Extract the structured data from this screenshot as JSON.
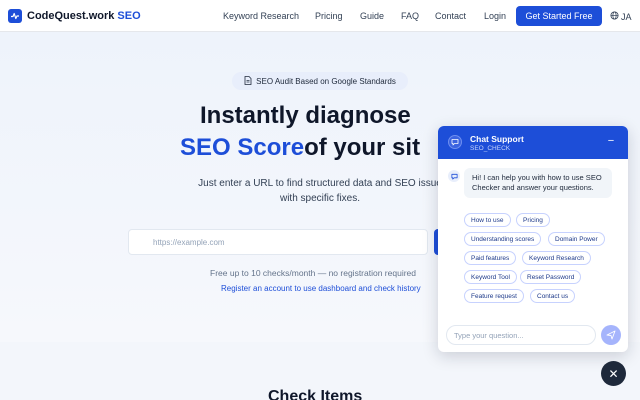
{
  "header": {
    "brand": "CodeQuest.work",
    "brand_accent": "SEO",
    "nav": [
      "Keyword Research",
      "Pricing",
      "Guide",
      "FAQ",
      "Contact",
      "Login"
    ],
    "cta": "Get Started Free",
    "lang": "JA"
  },
  "hero": {
    "badge": "SEO Audit Based on Google Standards",
    "headline_line1": "Instantly diagnose",
    "headline_blue": "SEO Score",
    "headline_rest": "of your sit",
    "subtitle_line1": "Just enter a URL to find structured data and SEO issue",
    "subtitle_line2": "with specific fixes.",
    "url_placeholder": "https://example.com",
    "free_note": "Free up to 10 checks/month — no registration required",
    "register_link": "Register an account to use dashboard and check history"
  },
  "section": {
    "title": "Check Items"
  },
  "chat": {
    "title": "Chat Support",
    "subtitle": "SEO_CHECK",
    "minimize": "−",
    "bot_message": "Hi! I can help you with how to use SEO Checker and answer your questions.",
    "chips": [
      "How to use",
      "Pricing",
      "Understanding scores",
      "Domain Power",
      "Paid features",
      "Keyword Research",
      "Keyword Tool",
      "Reset Password",
      "Feature request",
      "Contact us"
    ],
    "input_placeholder": "Type your question...",
    "close": "✕"
  },
  "colors": {
    "accent": "#1d4ed8",
    "dark": "#0f172a"
  },
  "icons": [
    "pulse-icon",
    "globe-icon",
    "document-icon",
    "chat-bubble-icon",
    "send-icon",
    "close-icon"
  ]
}
